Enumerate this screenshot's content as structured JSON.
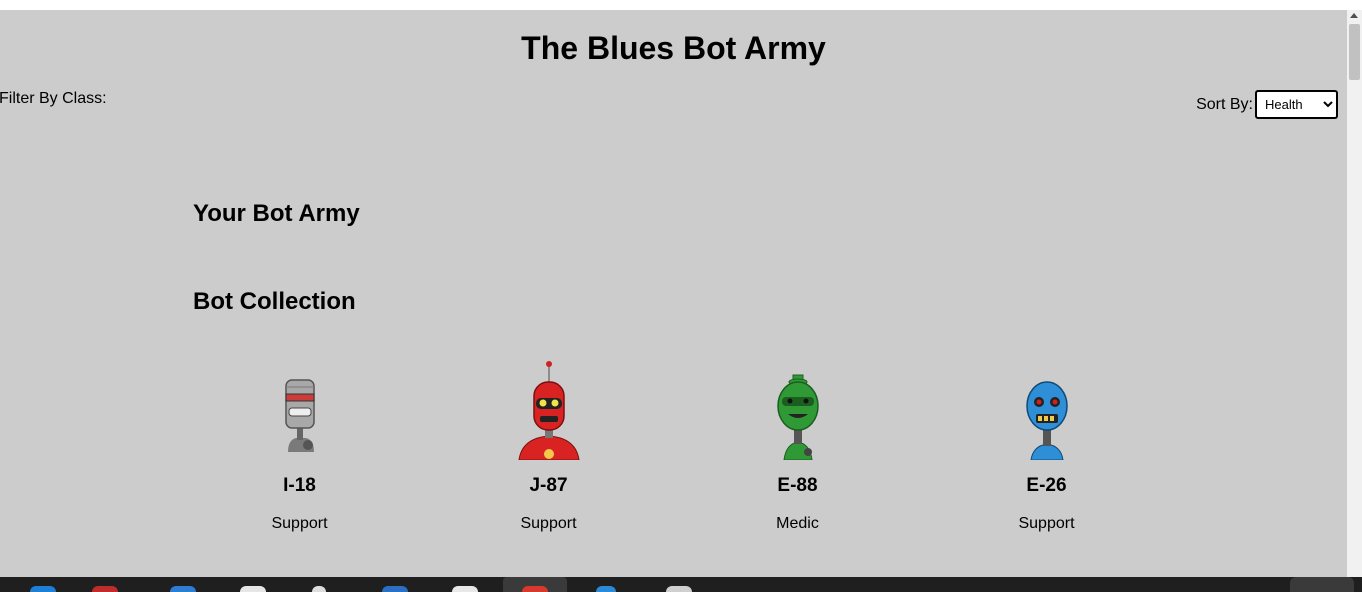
{
  "page": {
    "title": "The Blues Bot Army",
    "filter_label": "Filter By Class:",
    "sort_label": "Sort By:",
    "sort_selected": "Health",
    "sort_options": [
      "Health"
    ]
  },
  "sections": {
    "army_heading": "Your Bot Army",
    "collection_heading": "Bot Collection"
  },
  "bots": [
    {
      "name": "I-18",
      "bot_class": "Support",
      "color": "#9a9a9a"
    },
    {
      "name": "J-87",
      "bot_class": "Support",
      "color": "#d92323"
    },
    {
      "name": "E-88",
      "bot_class": "Medic",
      "color": "#2f9a35"
    },
    {
      "name": "E-26",
      "bot_class": "Support",
      "color": "#2e8fd6"
    }
  ],
  "colors": {
    "page_bg": "#cccccc",
    "taskbar_bg": "#1f1f1f"
  },
  "taskbar_icons": [
    "edge-icon",
    "red-app-icon",
    "files-icon",
    "doc-icon",
    "search-icon",
    "browser-icon",
    "chrome-icon",
    "red-circle-icon",
    "vscode-icon",
    "window-icon"
  ]
}
